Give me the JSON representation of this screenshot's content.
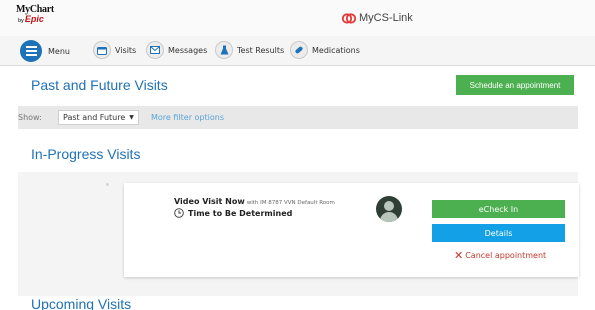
{
  "app": {
    "logo_line1": "MyChart",
    "logo_by": "by",
    "logo_line2": "Epic",
    "brand_name": "MyCS-Link",
    "brand_colors": {
      "logo_red": "#c0141a",
      "brand_mark": "#e53935"
    }
  },
  "nav": {
    "items": [
      {
        "label": "Menu",
        "icon": "hamburger-menu-icon"
      },
      {
        "label": "Visits",
        "icon": "calendar-icon"
      },
      {
        "label": "Messages",
        "icon": "envelope-icon"
      },
      {
        "label": "Test Results",
        "icon": "flask-icon"
      },
      {
        "label": "Medications",
        "icon": "pills-icon"
      }
    ]
  },
  "page": {
    "title": "Past and Future Visits",
    "schedule_button": "Schedule an appointment"
  },
  "filter": {
    "show_label": "Show:",
    "selected_option": "Past and Future",
    "more_filters": "More filter options"
  },
  "in_progress": {
    "title": "In-Progress Visits",
    "visit": {
      "type": "Video Visit Now",
      "location": "with IM 8787 VVN Default Room",
      "time": "Time to Be Determined",
      "echeck_label": "eCheck In",
      "details_label": "Details",
      "cancel_label": "Cancel appointment"
    }
  },
  "upcoming": {
    "title": "Upcoming Visits"
  },
  "colors": {
    "accent_blue": "#2172b4",
    "green_button": "#4caf50",
    "blue_button": "#14a0e6",
    "cancel_red": "#c0392b"
  }
}
